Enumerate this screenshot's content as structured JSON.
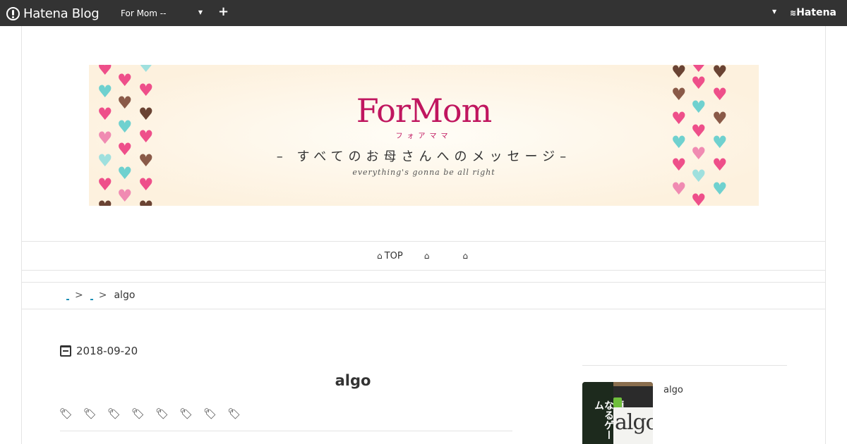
{
  "topbar": {
    "logo_text": "Hatena Blog",
    "blog_select_label": "For Mom --",
    "add_symbol": "+",
    "brand_text": "Hatena"
  },
  "banner": {
    "title": "ForMom",
    "kana": "フォアママ",
    "subtitle": "– すべてのお母さんへのメッセージ–",
    "tagline": "everything's gonna be all right"
  },
  "nav": {
    "items": [
      {
        "label": "TOP",
        "icon": "home-icon"
      },
      {
        "label": "",
        "icon": "home-icon"
      },
      {
        "label": "",
        "icon": "home-icon"
      }
    ]
  },
  "breadcrumb": {
    "separator": ">",
    "current": "algo"
  },
  "article": {
    "date": "2018-09-20",
    "title": "algo",
    "tag_count": 8
  },
  "sidebar": {
    "entries": [
      {
        "title": "algo",
        "thumb_text": "頭のよくなるゲーム",
        "thumb_logo": "algo"
      }
    ]
  },
  "colors": {
    "topbar_bg": "#333333",
    "brand_pink": "#c0165f",
    "link_blue": "#1d8fb5"
  }
}
